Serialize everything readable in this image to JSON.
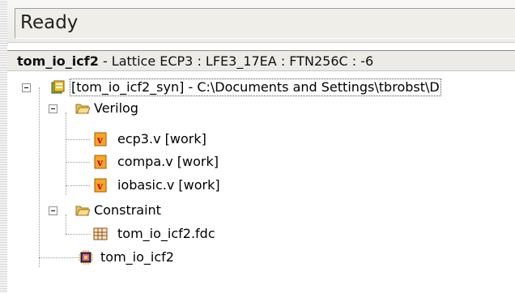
{
  "status_bar": {
    "text": "Ready"
  },
  "project_header": {
    "name": "tom_io_icf2",
    "details": " - Lattice ECP3 : LFE3_17EA : FTN256C : -6"
  },
  "tree": {
    "root": {
      "label": "[tom_io_icf2_syn]  -  C:\\Documents and Settings\\tbrobst\\D"
    },
    "verilog": {
      "label": "Verilog",
      "files": [
        "ecp3.v [work]",
        "compa.v [work]",
        "iobasic.v [work]"
      ]
    },
    "constraint": {
      "label": "Constraint",
      "files": [
        "tom_io_icf2.fdc"
      ]
    },
    "implementation": {
      "label": "tom_io_icf2"
    }
  },
  "icons": {
    "root": "project-icon",
    "verilog": "folder-open-icon",
    "file": "verilog-file-icon",
    "constraint": "folder-open-icon",
    "fdc": "constraint-file-icon",
    "implementation": "implementation-chip-icon"
  }
}
